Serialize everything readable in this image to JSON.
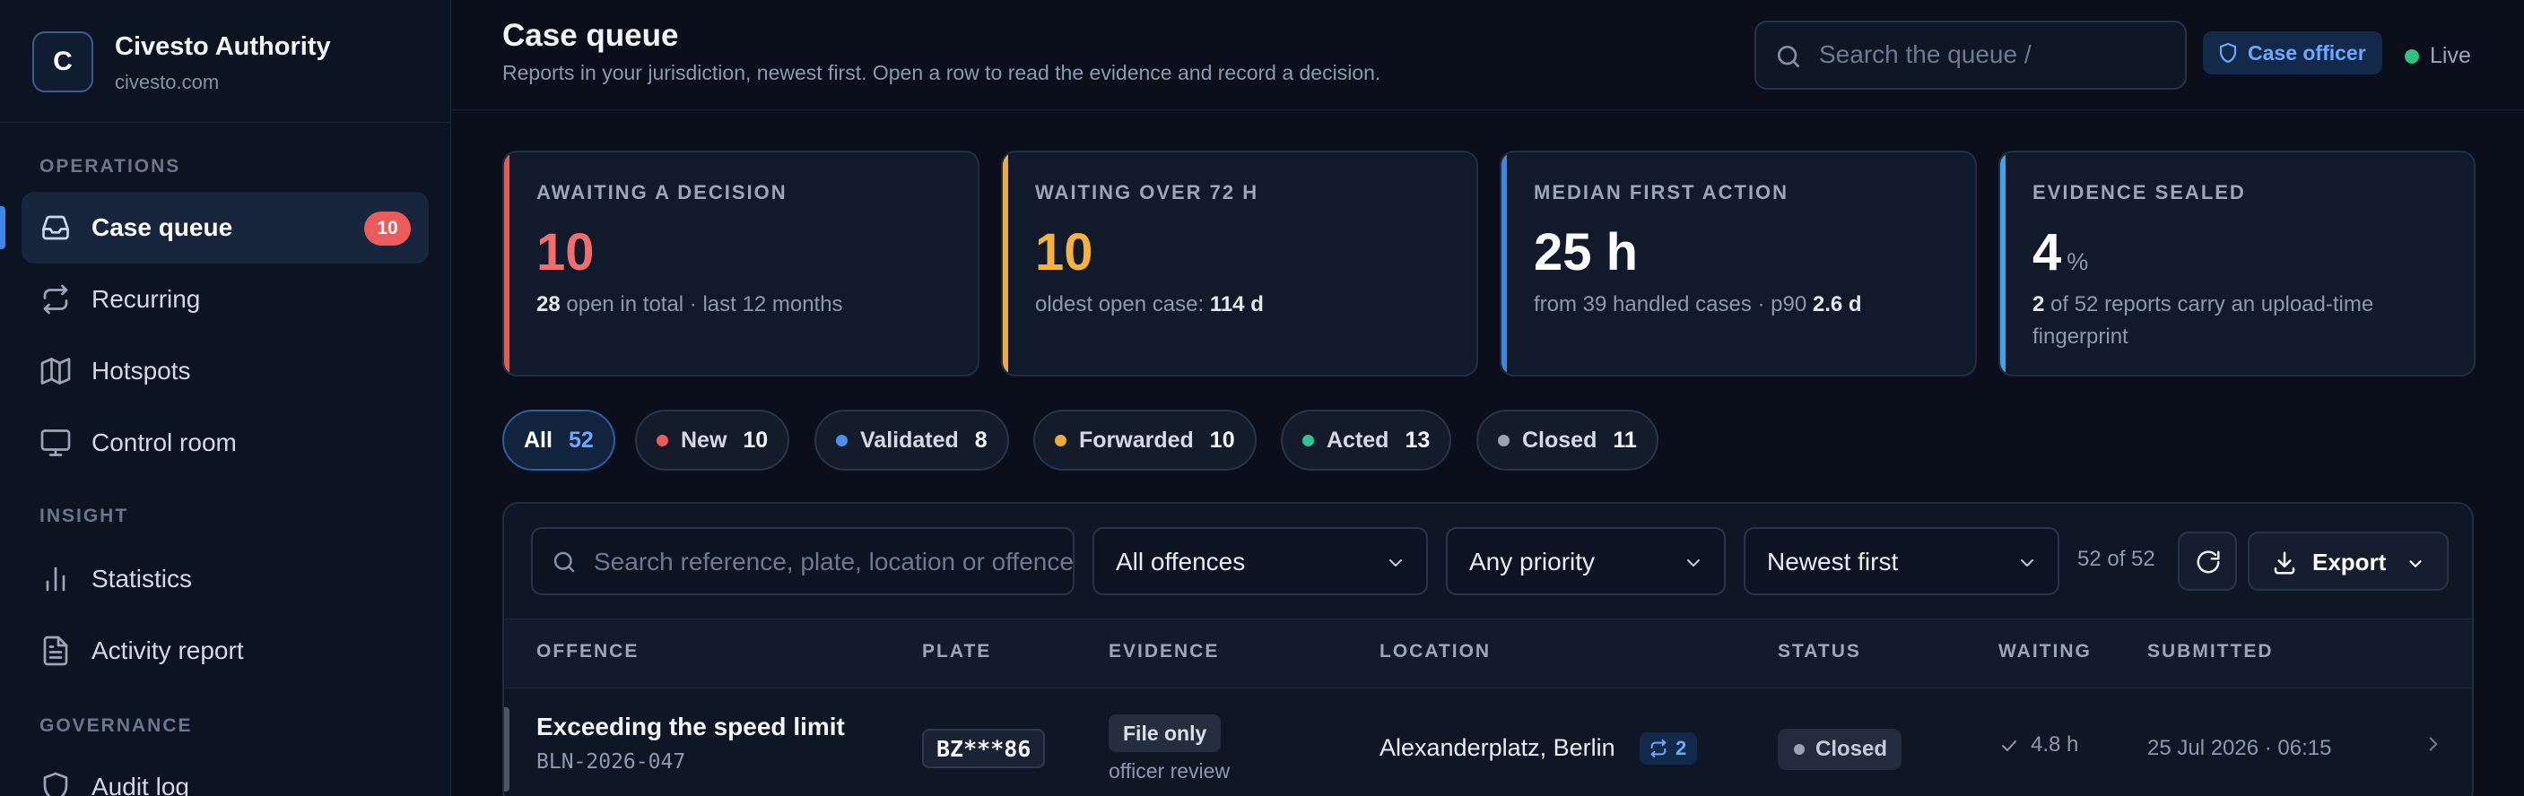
{
  "brand": {
    "initial": "C",
    "name": "Civesto Authority",
    "domain": "civesto.com"
  },
  "sidebar": {
    "sections": [
      {
        "title": "OPERATIONS",
        "items": [
          {
            "label": "Case queue",
            "icon": "inbox-icon",
            "active": true,
            "badge": "10"
          },
          {
            "label": "Recurring",
            "icon": "repeat-icon"
          },
          {
            "label": "Hotspots",
            "icon": "map-icon"
          },
          {
            "label": "Control room",
            "icon": "monitor-icon"
          }
        ]
      },
      {
        "title": "INSIGHT",
        "items": [
          {
            "label": "Statistics",
            "icon": "bar-chart-icon"
          },
          {
            "label": "Activity report",
            "icon": "document-icon"
          }
        ]
      },
      {
        "title": "GOVERNANCE",
        "items": [
          {
            "label": "Audit log",
            "icon": "shield-icon"
          }
        ]
      }
    ]
  },
  "header": {
    "title": "Case queue",
    "subtitle": "Reports in your jurisdiction, newest first. Open a row to read the evidence and record a decision.",
    "search_placeholder": "Search the queue  /",
    "role": "Case officer",
    "live_label": "Live"
  },
  "stats": [
    {
      "label": "AWAITING A DECISION",
      "value": "10",
      "unit": "",
      "color": "#f26d6d",
      "accent": "#e25a5a",
      "note_bold": "28",
      "note_rest": " open in total · last 12 months"
    },
    {
      "label": "WAITING OVER 72 H",
      "value": "10",
      "unit": "",
      "color": "#f5b33e",
      "accent": "#f2a93b",
      "note_pre": "oldest open case: ",
      "note_bold": "114 d"
    },
    {
      "label": "MEDIAN FIRST ACTION",
      "value": "25 h",
      "unit": "",
      "color": "#ffffff",
      "accent": "#3f86e8",
      "note_pre": "from 39 handled cases · p90 ",
      "note_bold": "2.6 d"
    },
    {
      "label": "EVIDENCE SEALED",
      "value": "4",
      "unit": "%",
      "color": "#ffffff",
      "accent": "#3fa3e8",
      "note_bold": "2",
      "note_rest": " of 52 reports carry an upload-time fingerprint"
    }
  ],
  "filters": [
    {
      "label": "All",
      "count": "52",
      "active": true,
      "dot": ""
    },
    {
      "label": "New",
      "count": "10",
      "dot": "#ec5b5b"
    },
    {
      "label": "Validated",
      "count": "8",
      "dot": "#4d8fe8"
    },
    {
      "label": "Forwarded",
      "count": "10",
      "dot": "#f2a93b"
    },
    {
      "label": "Acted",
      "count": "13",
      "dot": "#2ec39a"
    },
    {
      "label": "Closed",
      "count": "11",
      "dot": "#9aa3b2"
    }
  ],
  "toolbar": {
    "search_placeholder": "Search reference, plate, location or offence",
    "offence_select": "All offences",
    "priority_select": "Any priority",
    "sort_select": "Newest first",
    "count_text": "52 of 52",
    "export_label": "Export"
  },
  "table": {
    "columns": [
      "OFFENCE",
      "PLATE",
      "EVIDENCE",
      "LOCATION",
      "STATUS",
      "WAITING",
      "SUBMITTED"
    ],
    "rows": [
      {
        "offence": "Exceeding the speed limit",
        "reference": "BLN-2026-047",
        "plate": "BZ***86",
        "evidence": "File only",
        "evidence_note": "officer review",
        "location": "Alexanderplatz, Berlin",
        "recurring_count": "2",
        "status": "Closed",
        "waiting": "4.8 h",
        "submitted": "25 Jul 2026 · 06:15"
      }
    ]
  }
}
